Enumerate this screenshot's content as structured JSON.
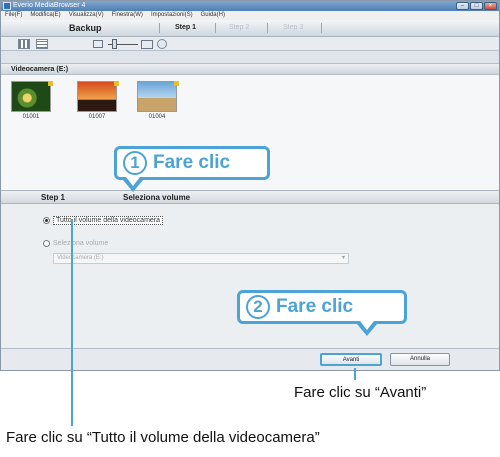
{
  "window": {
    "title": "Everio MediaBrowser 4",
    "controls": {
      "minimize": "–",
      "maximize": "□",
      "close": "×"
    }
  },
  "menu": [
    "File(F)",
    "Modifica(E)",
    "Visualizza(V)",
    "Finestra(W)",
    "Impostazioni(S)",
    "Guida(H)"
  ],
  "steps": {
    "mode": "Backup",
    "step1": "Step 1",
    "step2": "Step 2",
    "step3": "Step 3"
  },
  "device": {
    "name": "Videocamera (E:)"
  },
  "thumbnails": [
    {
      "caption": "01001",
      "icon": "flower-photo"
    },
    {
      "caption": "01007",
      "icon": "airplane-photo"
    },
    {
      "caption": "01004",
      "icon": "pyramid-photo"
    }
  ],
  "panel": {
    "step_label": "Step 1",
    "title": "Seleziona volume",
    "option_all": "Tutto il volume della videocamera",
    "option_select": "Seleziona volume",
    "select_value": "Videocamera (E:)"
  },
  "buttons": {
    "next": "Avanti",
    "cancel": "Annulla"
  },
  "callouts": {
    "one_num": "1",
    "one_text": "Fare clic",
    "two_num": "2",
    "two_text": "Fare clic"
  },
  "annotations": {
    "avanti": "Fare clic su “Avanti”",
    "tutto": "Fare clic su “Tutto il volume della videocamera”"
  },
  "colors": {
    "accent": "#4ca3d6",
    "titlebar": "#4f7fb4"
  }
}
